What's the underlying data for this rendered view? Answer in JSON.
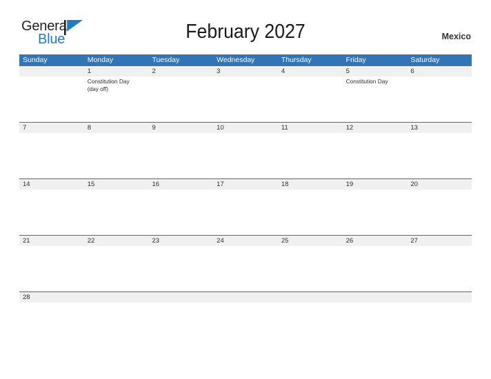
{
  "brand": {
    "name_part1": "General",
    "name_part2": "Blue",
    "flag_icon": "blue-flag-icon",
    "colors": {
      "text_dark": "#231f20",
      "blue": "#1f7cc2"
    }
  },
  "header": {
    "title": "February 2027",
    "country": "Mexico"
  },
  "theme": {
    "header_blue": "#3274b5",
    "row_divider_blue": "#2f6fa8",
    "date_band_gray": "#f0f0f0"
  },
  "calendar": {
    "month": "February",
    "year": "2027",
    "weekday_headers": [
      "Sunday",
      "Monday",
      "Tuesday",
      "Wednesday",
      "Thursday",
      "Friday",
      "Saturday"
    ],
    "weeks": [
      {
        "days": [
          {
            "date": "",
            "events": []
          },
          {
            "date": "1",
            "events": [
              "Constitution Day",
              "(day off)"
            ]
          },
          {
            "date": "2",
            "events": []
          },
          {
            "date": "3",
            "events": []
          },
          {
            "date": "4",
            "events": []
          },
          {
            "date": "5",
            "events": [
              "Constitution Day"
            ]
          },
          {
            "date": "6",
            "events": []
          }
        ]
      },
      {
        "days": [
          {
            "date": "7",
            "events": []
          },
          {
            "date": "8",
            "events": []
          },
          {
            "date": "9",
            "events": []
          },
          {
            "date": "10",
            "events": []
          },
          {
            "date": "11",
            "events": []
          },
          {
            "date": "12",
            "events": []
          },
          {
            "date": "13",
            "events": []
          }
        ]
      },
      {
        "days": [
          {
            "date": "14",
            "events": []
          },
          {
            "date": "15",
            "events": []
          },
          {
            "date": "16",
            "events": []
          },
          {
            "date": "17",
            "events": []
          },
          {
            "date": "18",
            "events": []
          },
          {
            "date": "19",
            "events": []
          },
          {
            "date": "20",
            "events": []
          }
        ]
      },
      {
        "days": [
          {
            "date": "21",
            "events": []
          },
          {
            "date": "22",
            "events": []
          },
          {
            "date": "23",
            "events": []
          },
          {
            "date": "24",
            "events": []
          },
          {
            "date": "25",
            "events": []
          },
          {
            "date": "26",
            "events": []
          },
          {
            "date": "27",
            "events": []
          }
        ]
      },
      {
        "short": true,
        "days": [
          {
            "date": "28",
            "events": []
          },
          {
            "date": "",
            "events": []
          },
          {
            "date": "",
            "events": []
          },
          {
            "date": "",
            "events": []
          },
          {
            "date": "",
            "events": []
          },
          {
            "date": "",
            "events": []
          },
          {
            "date": "",
            "events": []
          }
        ]
      }
    ]
  }
}
